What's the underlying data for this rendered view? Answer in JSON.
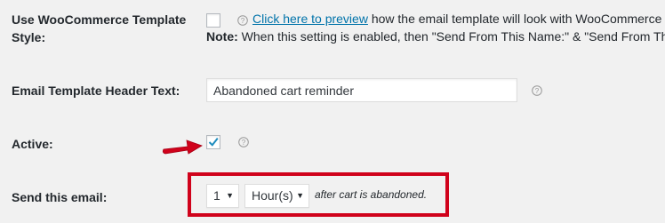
{
  "settings": {
    "template_style": {
      "label_line1": "Use WooCommerce Template",
      "label_line2": "Style:",
      "preview_link": "Click here to preview",
      "preview_rest": " how the email template will look with WooCommerce",
      "note_bold": "Note:",
      "note_text": " When this setting is enabled, then \"Send From This Name:\" & \"Send From Thi"
    },
    "header_text": {
      "label": "Email Template Header Text:",
      "value": "Abandoned cart reminder"
    },
    "active": {
      "label": "Active:",
      "checked": true
    },
    "send_email": {
      "label": "Send this email:",
      "number_value": "1",
      "unit_value": "Hour(s)",
      "after_text": "after cart is abandoned."
    }
  },
  "colors": {
    "background": "#f1f1f1",
    "link": "#0073aa",
    "highlight_red": "#d0021b",
    "checkmark_blue": "#1e8cbe"
  },
  "icons": {
    "help": "question-circle-icon",
    "arrow": "red-arrow-icon",
    "checkmark": "checkmark-icon",
    "dropdown": "triangle-down-icon"
  }
}
